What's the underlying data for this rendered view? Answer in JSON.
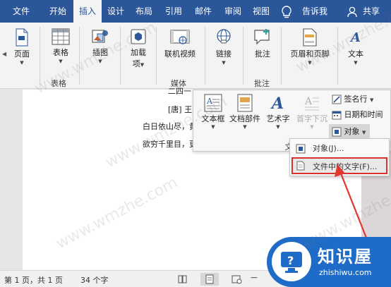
{
  "menubar": {
    "tabs": [
      {
        "id": "file",
        "label": "文件"
      },
      {
        "id": "home",
        "label": "开始"
      },
      {
        "id": "insert",
        "label": "插入",
        "active": true
      },
      {
        "id": "design",
        "label": "设计"
      },
      {
        "id": "layout",
        "label": "布局"
      },
      {
        "id": "references",
        "label": "引用"
      },
      {
        "id": "mailings",
        "label": "邮件"
      },
      {
        "id": "review",
        "label": "审阅"
      },
      {
        "id": "view",
        "label": "视图"
      }
    ],
    "tell_me": "告诉我",
    "share": "共享",
    "accent_color": "#2b579a"
  },
  "ribbon": {
    "pages": "页面",
    "table": "表格",
    "table_group": "表格",
    "illustrations": "插图",
    "addins_line1": "加载",
    "addins_line2": "项",
    "online_video": "联机视频",
    "media_group": "媒体",
    "link": "链接",
    "comment": "批注",
    "comments_group": "批注",
    "header_footer": "页眉和页脚",
    "text": "文本"
  },
  "document": {
    "line0": "二四一",
    "author": "[唐] 王",
    "line1": "白日依山尽，黄",
    "line2": "欲穷千里目，更"
  },
  "text_group": {
    "textbox": "文本框",
    "quick_parts": "文档部件",
    "wordart": "艺术字",
    "dropcap": "首字下沉",
    "signature_line": "签名行",
    "date_time": "日期和时间",
    "object": "对象",
    "group_label_partial": "文"
  },
  "object_menu": {
    "object_item": "对象(J)...",
    "text_from_file": "文件中的文字(F)..."
  },
  "statusbar": {
    "page": "第 1 页，共 1 页",
    "words": "34 个字"
  },
  "badge": {
    "name": "知识屋",
    "domain": "zhishiwu.com",
    "color": "#1e6cc8"
  },
  "watermark": "www.wmzhe.com"
}
